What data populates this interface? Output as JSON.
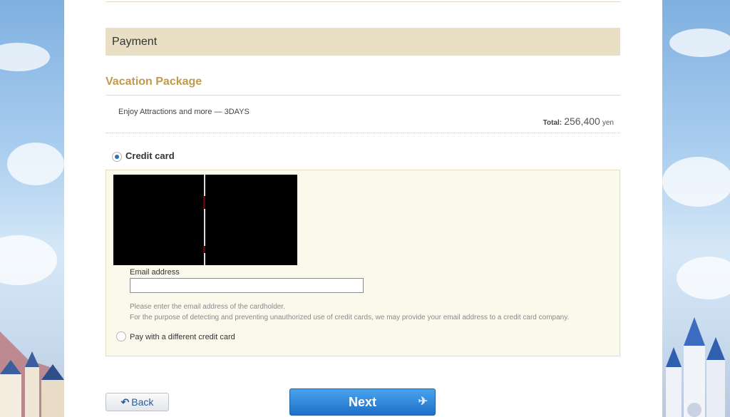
{
  "payment": {
    "section_title": "Payment",
    "package_title": "Vacation Package",
    "package_description": "Enjoy Attractions and more — 3DAYS",
    "total_label": "Total:",
    "total_amount": "256,400",
    "total_unit": "yen"
  },
  "credit_card": {
    "label": "Credit card",
    "selected": true,
    "email_label": "Email address",
    "email_value": "",
    "email_placeholder": "",
    "help_line1": "Please enter the email address of the cardholder.",
    "help_line2": "For the purpose of detecting and preventing unauthorized use of credit cards, we may provide your email address to a credit card company.",
    "different_card_label": "Pay with a different credit card"
  },
  "nav": {
    "back_label": "Back",
    "back_icon": "return-arrow-icon",
    "next_label": "Next",
    "next_icon": "airplane-icon"
  },
  "colors": {
    "accent_gold": "#c19a4d",
    "header_beige": "#e8dfc5",
    "panel_cream": "#fbf8ec",
    "next_blue": "#1e70c7"
  }
}
